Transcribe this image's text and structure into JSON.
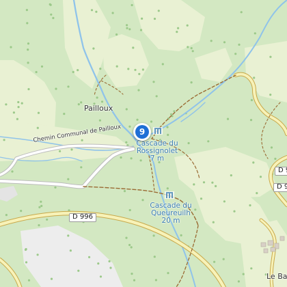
{
  "map": {
    "labels": {
      "pailloux": "Pailloux",
      "chemin": "Chemin Communal de Pailloux",
      "cascade_rossignolet": "Cascade du Rossignolet",
      "cascade_rossignolet_elev": "7 m",
      "cascade_queureuilh": "Cascade du Queureuilh",
      "cascade_queureuilh_elev": "20 m",
      "d996": "D 996",
      "d9_top": "D 9",
      "d9_right": "D 9",
      "le_bar": "Le Bar"
    },
    "marker": {
      "number": "9",
      "color": "#1f6fd6"
    },
    "icons": {
      "waterfall": "waterfall-icon",
      "map_pin": "map-pin-icon"
    },
    "colors": {
      "forest": "#d3e8c2",
      "meadow": "#e9f1d3",
      "rock": "#ededed",
      "water": "#8fc3ea",
      "road": "#f7f2b8",
      "road_edge": "#c8a84a",
      "track": "#9a6a33",
      "white_road": "#ffffff"
    }
  }
}
